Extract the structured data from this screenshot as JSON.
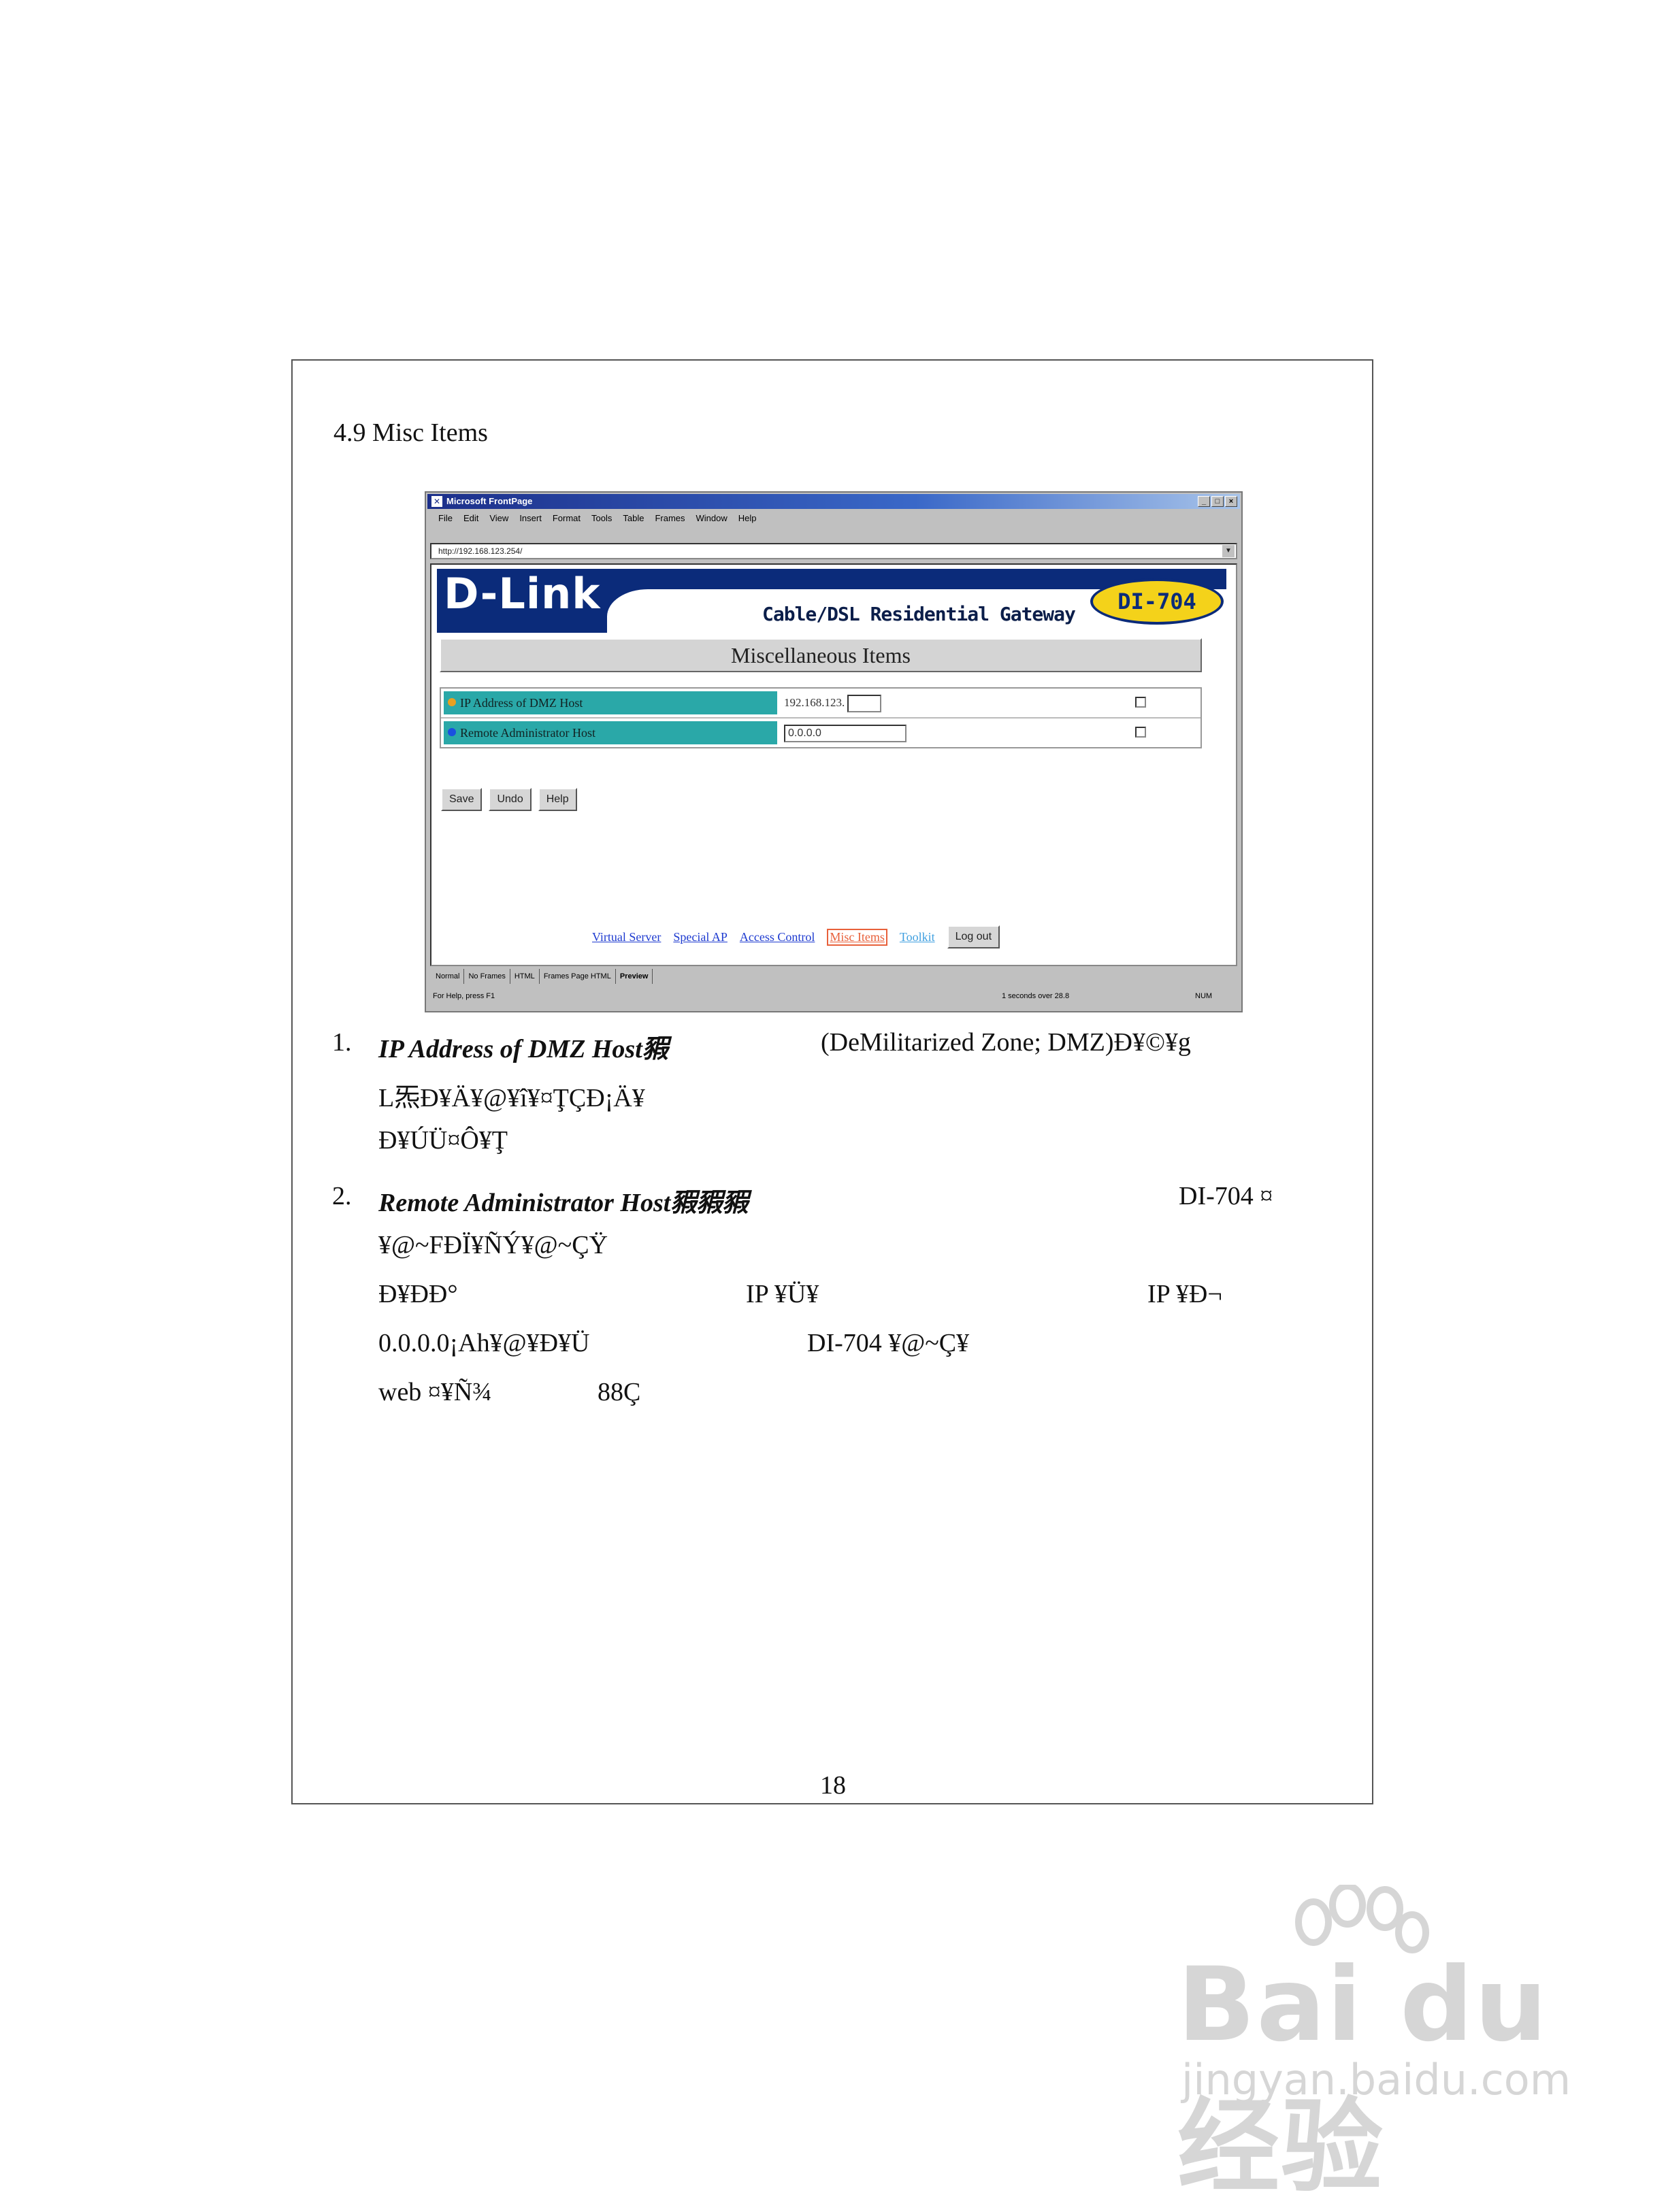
{
  "section_title": "4.9 Misc Items",
  "page_number": "18",
  "screenshot": {
    "window_title": "Microsoft FrontPage",
    "menu": [
      "File",
      "Edit",
      "View",
      "Insert",
      "Format",
      "Tools",
      "Table",
      "Frames",
      "Window",
      "Help"
    ],
    "address": "http://192.168.123.254/",
    "logo": "D-Link",
    "product_line": "Cable/DSL Residential Gateway",
    "model": "DI-704",
    "panel_title": "Miscellaneous Items",
    "rows": [
      {
        "label": "IP Address of DMZ Host",
        "prefix": "192.168.123.",
        "value": ""
      },
      {
        "label": "Remote Administrator Host",
        "value": "0.0.0.0"
      }
    ],
    "buttons": [
      "Save",
      "Undo",
      "Help"
    ],
    "links": [
      "Virtual Server",
      "Special AP",
      "Access Control",
      "Misc Items",
      "Toolkit"
    ],
    "logout_button": "Log out",
    "sheet_tabs": [
      "Normal",
      "No Frames",
      "HTML",
      "Frames Page HTML",
      "Preview"
    ],
    "status_left": "For Help, press F1",
    "status_right": "1 seconds over 28.8",
    "status_mode": "NUM"
  },
  "items": [
    {
      "num": "1.",
      "lines": [
        {
          "text": "IP Address of DMZ Host豭",
          "italic": true
        },
        {
          "text": "(DeMilitarized Zone; DMZ)Ð¥©¥g"
        },
        {
          "text": "L炁Ð¥Ä¥@¥î¥¤ŢÇÐ¡Ä¥"
        },
        {
          "text": "Ð¥ÚÜ¤Ô¥Ţ"
        }
      ]
    },
    {
      "num": "2.",
      "lines": [
        {
          "text": "Remote Administrator Host豭豭豭",
          "italic": true
        },
        {
          "text": "DI-704 ¤"
        },
        {
          "text": "¥@~FÐÏ¥ÑÝ¥@~ÇŸ"
        },
        {
          "text": "Ð¥ÐÐ°"
        },
        {
          "text": "IP ¥Ü¥"
        },
        {
          "text": "IP ¥Ð¬"
        },
        {
          "text": "0.0.0.0¡Ah¥@¥Ð¥Ü"
        },
        {
          "text": "DI-704 ¥@~Ç¥"
        },
        {
          "text": "web ¤¥Ñ¾"
        },
        {
          "text": "88Ç"
        }
      ]
    }
  ],
  "watermark": {
    "brand": "Bai du 经验",
    "url": "jingyan.baidu.com"
  },
  "colors": {
    "dlink_navy": "#0b2b7a",
    "badge_yellow": "#f4d21a",
    "row_teal": "#2aa8a8",
    "link_blue": "#1d3ad0",
    "active_link": "#e8603a"
  }
}
